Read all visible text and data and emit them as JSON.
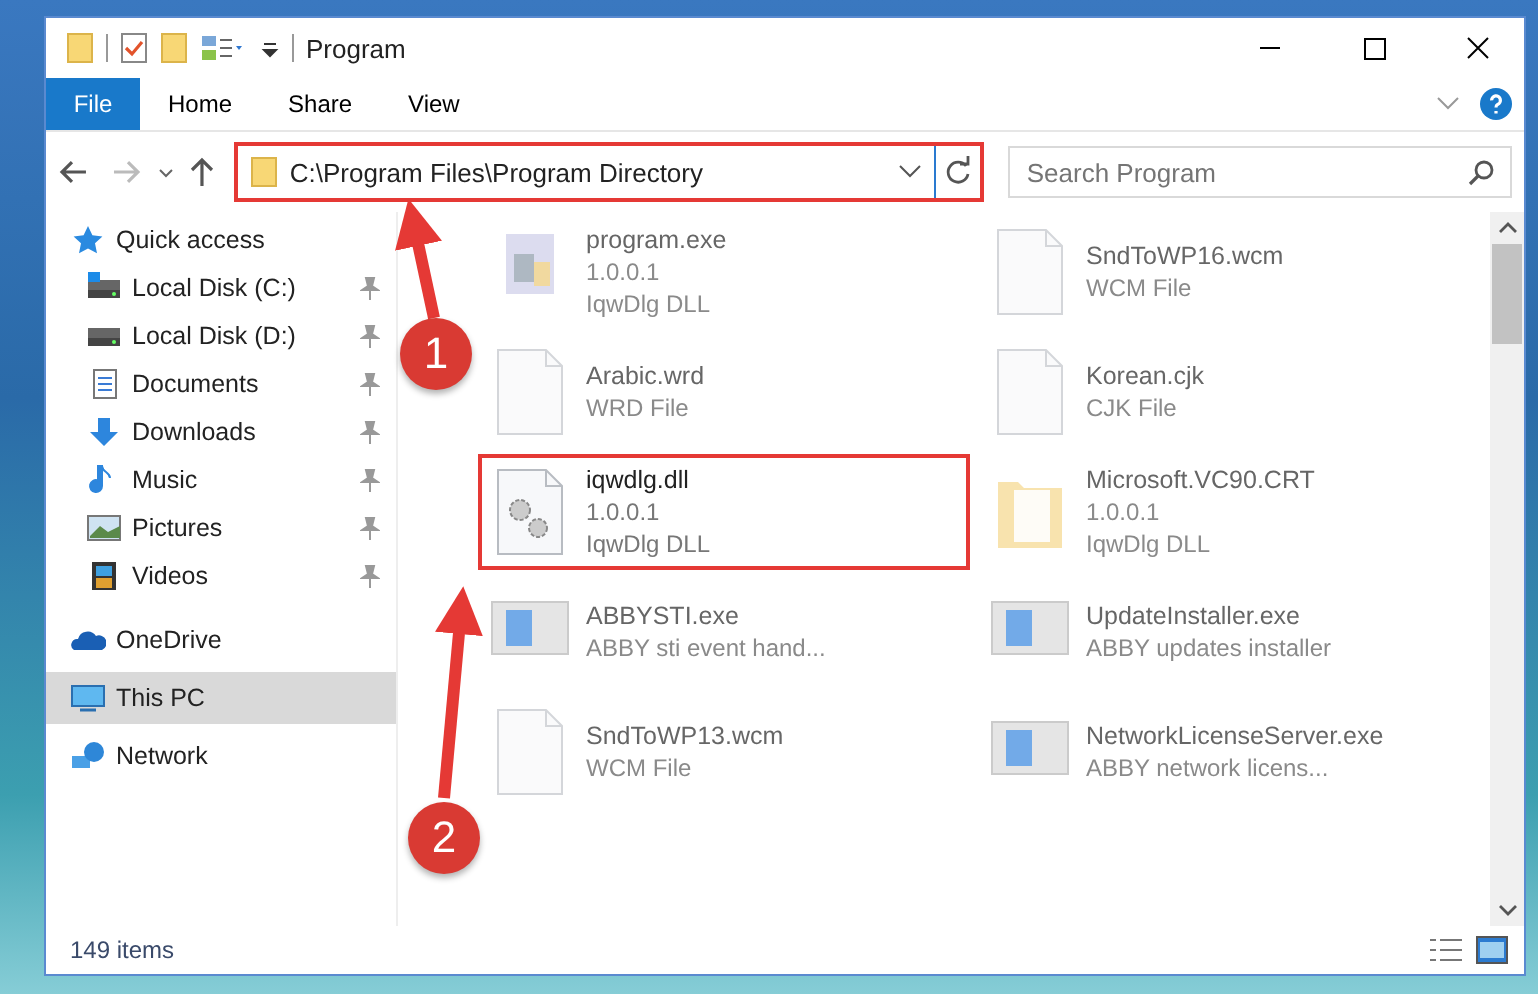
{
  "window": {
    "title": "Program"
  },
  "ribbon": {
    "file_button": "File",
    "tabs": [
      {
        "label": "Home"
      },
      {
        "label": "Share"
      },
      {
        "label": "View"
      }
    ]
  },
  "address_bar": {
    "path": "C:\\Program Files\\Program Directory",
    "highlighted": true
  },
  "search": {
    "placeholder": "Search Program"
  },
  "sidebar": {
    "items": [
      {
        "label": "Quick access",
        "kind": "star",
        "selected": false,
        "children": [
          {
            "label": "Local Disk (C:)",
            "kind": "disk-c",
            "pinned": true
          },
          {
            "label": "Local Disk (D:)",
            "kind": "disk",
            "pinned": true
          },
          {
            "label": "Documents",
            "kind": "documents",
            "pinned": true
          },
          {
            "label": "Downloads",
            "kind": "downloads",
            "pinned": true
          },
          {
            "label": "Music",
            "kind": "music",
            "pinned": true
          },
          {
            "label": "Pictures",
            "kind": "pictures",
            "pinned": true
          },
          {
            "label": "Videos",
            "kind": "videos",
            "pinned": true
          }
        ]
      },
      {
        "label": "OneDrive",
        "kind": "cloud",
        "selected": false
      },
      {
        "label": "This PC",
        "kind": "pc",
        "selected": true
      },
      {
        "label": "Network",
        "kind": "network",
        "selected": false
      }
    ]
  },
  "files": [
    {
      "kind": "program",
      "name": "program.exe",
      "details": [
        "1.0.0.1",
        "IqwDlg DLL"
      ],
      "blurred": true,
      "highlighted": false
    },
    {
      "kind": "document",
      "name": "SndToWP16.wcm",
      "details": [
        "WCM File"
      ],
      "blurred": true,
      "highlighted": false
    },
    {
      "kind": "document",
      "name": "Arabic.wrd",
      "details": [
        "WRD File"
      ],
      "blurred": true,
      "highlighted": false
    },
    {
      "kind": "document",
      "name": "Korean.cjk",
      "details": [
        "CJK File"
      ],
      "blurred": true,
      "highlighted": false
    },
    {
      "kind": "dll",
      "name": "iqwdlg.dll",
      "details": [
        "1.0.0.1",
        "IqwDlg DLL"
      ],
      "blurred": false,
      "highlighted": true
    },
    {
      "kind": "folder",
      "name": "Microsoft.VC90.CRT",
      "details": [
        "1.0.0.1",
        "IqwDlg DLL"
      ],
      "blurred": true,
      "highlighted": false
    },
    {
      "kind": "app",
      "name": "ABBYSTI.exe",
      "details": [
        "ABBY sti event hand..."
      ],
      "blurred": true,
      "highlighted": false
    },
    {
      "kind": "app",
      "name": "UpdateInstaller.exe",
      "details": [
        "ABBY updates installer"
      ],
      "blurred": true,
      "highlighted": false
    },
    {
      "kind": "document",
      "name": "SndToWP13.wcm",
      "details": [
        "WCM File"
      ],
      "blurred": true,
      "highlighted": false
    },
    {
      "kind": "app",
      "name": "NetworkLicenseServer.exe",
      "details": [
        "ABBY network licens..."
      ],
      "blurred": true,
      "highlighted": false
    }
  ],
  "status_bar": {
    "count": "149 items"
  },
  "annotations": [
    {
      "number": "1"
    },
    {
      "number": "2"
    }
  ]
}
